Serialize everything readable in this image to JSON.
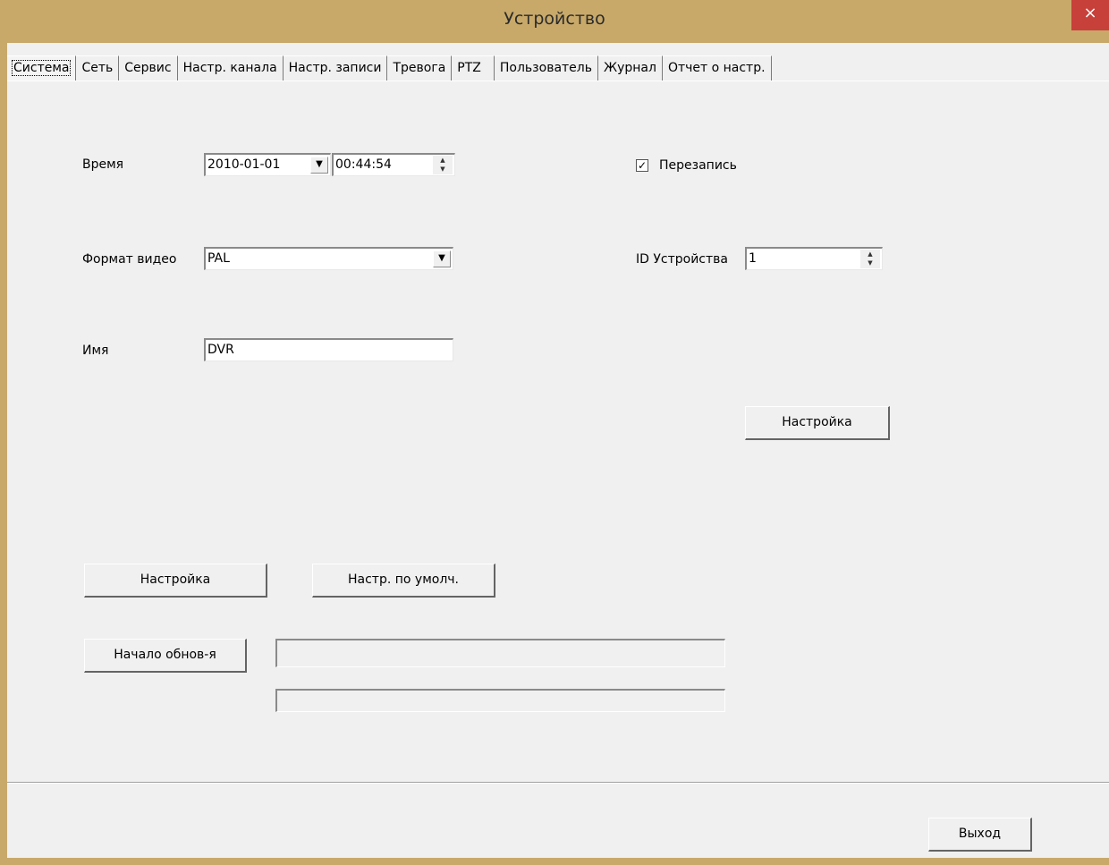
{
  "window": {
    "title": "Устройство",
    "close_label": "×"
  },
  "tabs": [
    {
      "label": "Система"
    },
    {
      "label": "Сеть"
    },
    {
      "label": "Сервис"
    },
    {
      "label": "Настр. канала"
    },
    {
      "label": "Настр. записи"
    },
    {
      "label": "Тревога"
    },
    {
      "label": "PTZ"
    },
    {
      "label": "Пользователь"
    },
    {
      "label": "Журнал"
    },
    {
      "label": "Отчет о настр."
    }
  ],
  "system": {
    "time_label": "Время",
    "date_value": "2010-01-01",
    "time_value": "00:44:54",
    "overwrite_label": "Перезапись",
    "overwrite_checked": true,
    "video_format_label": "Формат видео",
    "video_format_value": "PAL",
    "device_id_label": "ID Устройства",
    "device_id_value": "1",
    "name_label": "Имя",
    "name_value": "DVR",
    "setup_button_right": "Настройка",
    "setup_button_left": "Настройка",
    "defaults_button": "Настр. по умолч.",
    "upgrade_button": "Начало обнов-я",
    "upgrade_path_value": "",
    "upgrade_progress": 0
  },
  "footer": {
    "exit_button": "Выход"
  },
  "icons": {
    "dropdown": "▼",
    "check": "✓",
    "spin_up": "▲",
    "spin_down": "▼"
  }
}
